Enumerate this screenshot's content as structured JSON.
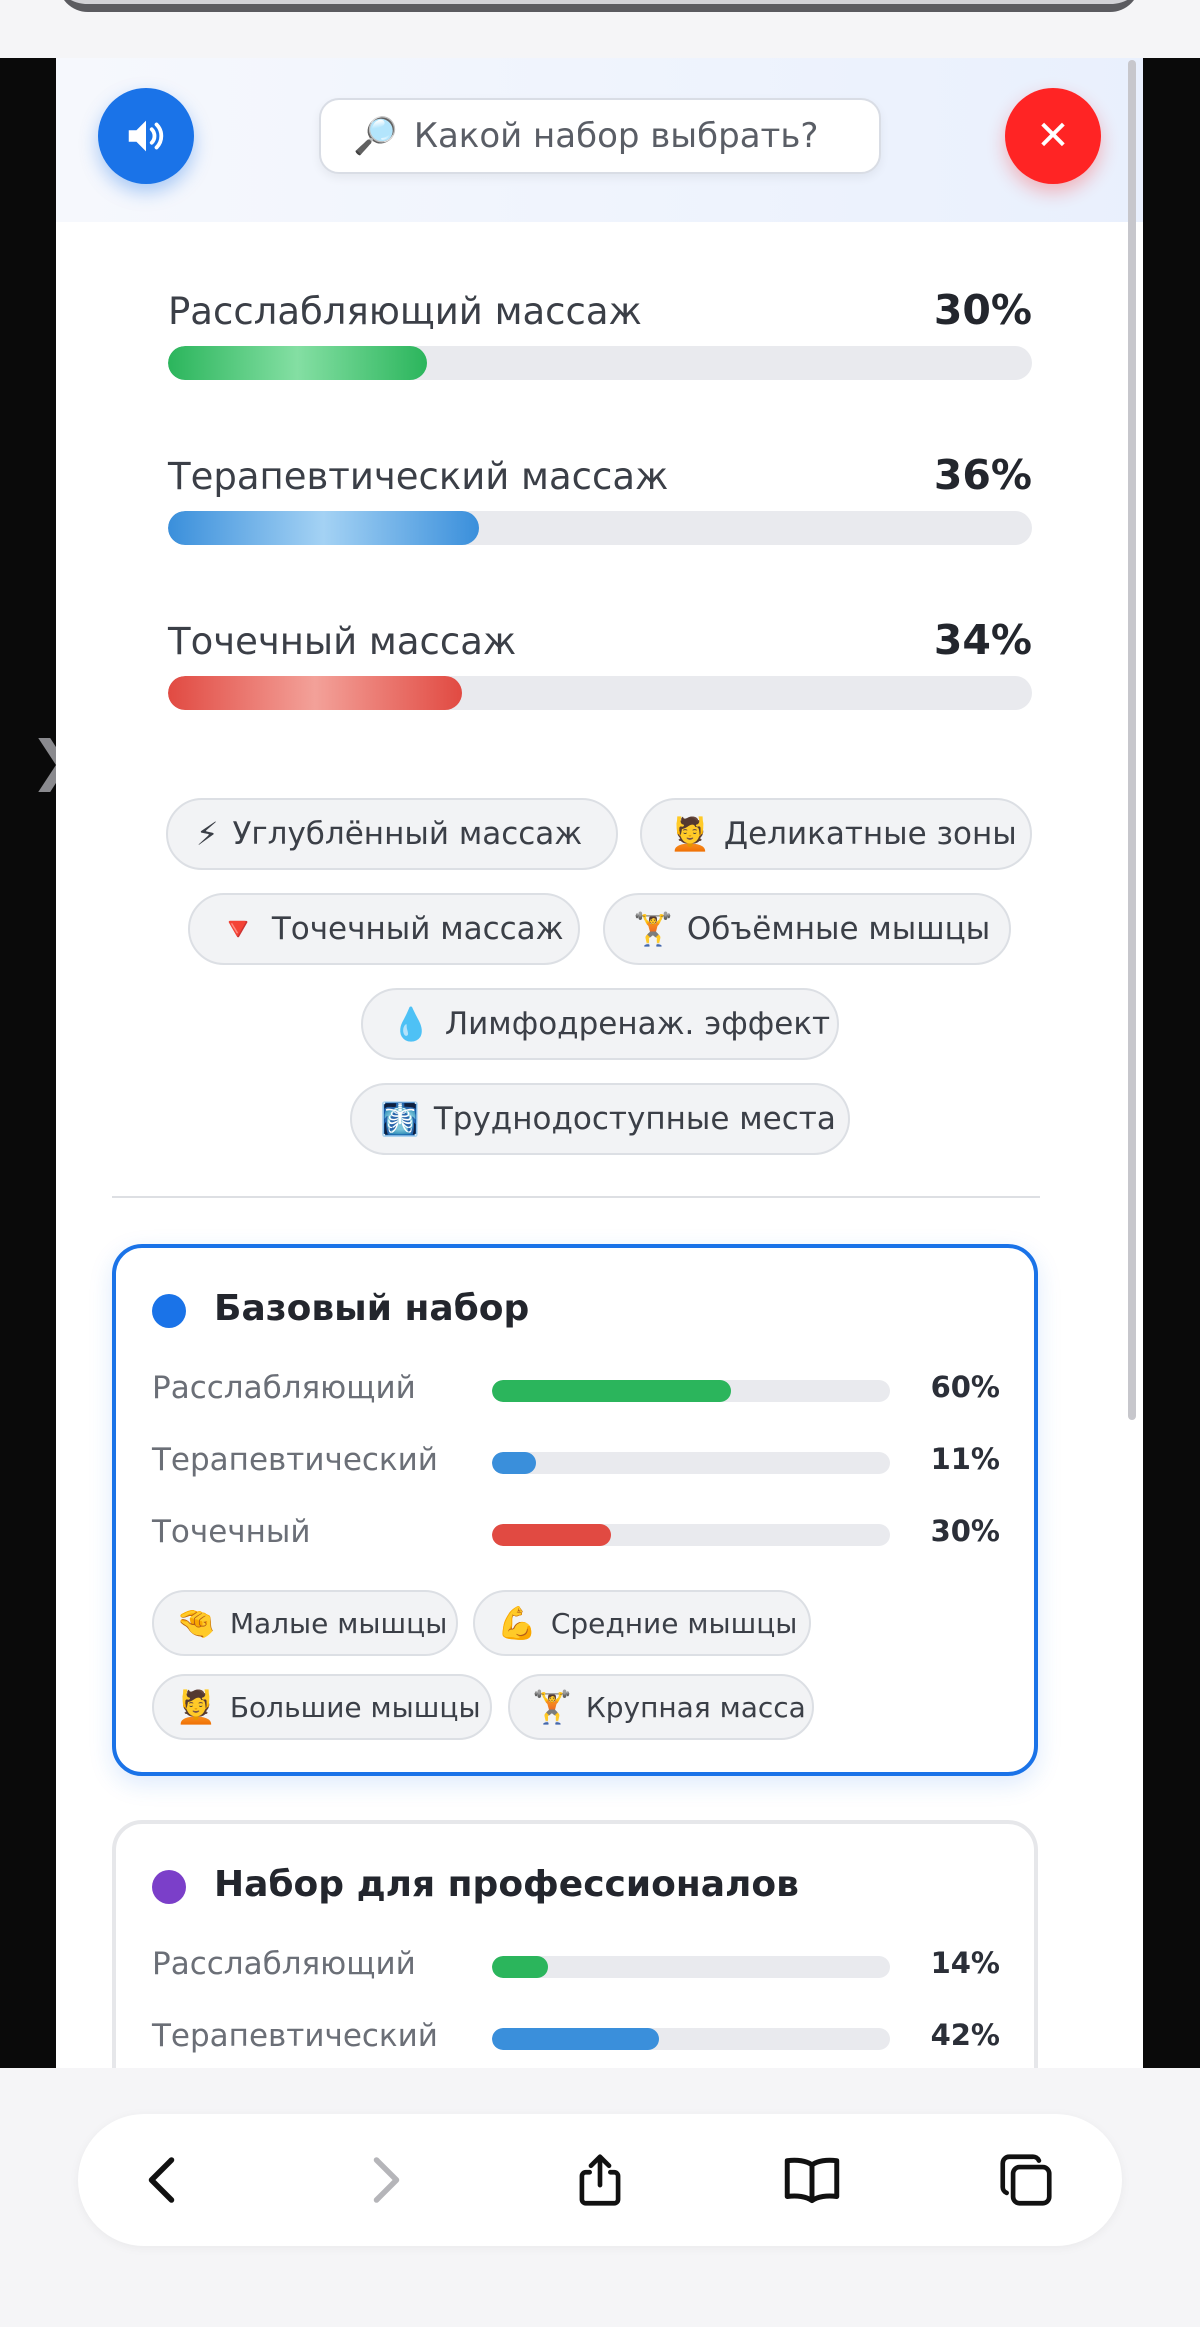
{
  "search": {
    "icon": "magnifier-icon",
    "text": "Какой набор выбрать?"
  },
  "stats": [
    {
      "label": "Расслабляющий массаж",
      "percent": "30%",
      "value": 30,
      "color": "#2bb55c"
    },
    {
      "label": "Терапевтический массаж",
      "percent": "36%",
      "value": 36,
      "color": "#3a8fdb"
    },
    {
      "label": "Точечный массаж",
      "percent": "34%",
      "value": 34,
      "color": "#e14a42"
    }
  ],
  "features": [
    {
      "icon": "⚡",
      "label": "Углублённый массаж"
    },
    {
      "icon": "💆",
      "label": "Деликатные зоны"
    },
    {
      "icon": "🔻",
      "label": "Точечный массаж"
    },
    {
      "icon": "🏋",
      "label": "Объёмные мышцы"
    },
    {
      "icon": "💧",
      "label": "Лимфодренаж. эффект"
    },
    {
      "icon": "🩻",
      "label": "Труднодоступные места"
    }
  ],
  "cards": [
    {
      "title": "Базовый набор",
      "dot_color": "#1a73e8",
      "rows": [
        {
          "label": "Расслабляющий",
          "percent": "60%",
          "value": 60
        },
        {
          "label": "Терапевтический",
          "percent": "11%",
          "value": 11
        },
        {
          "label": "Точечный",
          "percent": "30%",
          "value": 30
        }
      ],
      "tags": [
        {
          "icon": "🤏",
          "label": "Малые мышцы"
        },
        {
          "icon": "💪",
          "label": "Средние мышцы"
        },
        {
          "icon": "💆",
          "label": "Большие мышцы"
        },
        {
          "icon": "🏋",
          "label": "Крупная масса"
        }
      ]
    },
    {
      "title": "Набор для профессионалов",
      "dot_color": "#7b3fc9",
      "rows": [
        {
          "label": "Расслабляющий",
          "percent": "14%",
          "value": 14
        },
        {
          "label": "Терапевтический",
          "percent": "42%",
          "value": 42
        }
      ]
    }
  ],
  "side_arrow": "❯",
  "icons": {
    "sound": "speaker-icon",
    "close": "close-icon",
    "back": "back-arrow-icon",
    "forward": "forward-arrow-icon",
    "share": "share-icon",
    "bookmarks": "book-icon",
    "tabs": "tabs-icon"
  },
  "close_symbol": "✕"
}
